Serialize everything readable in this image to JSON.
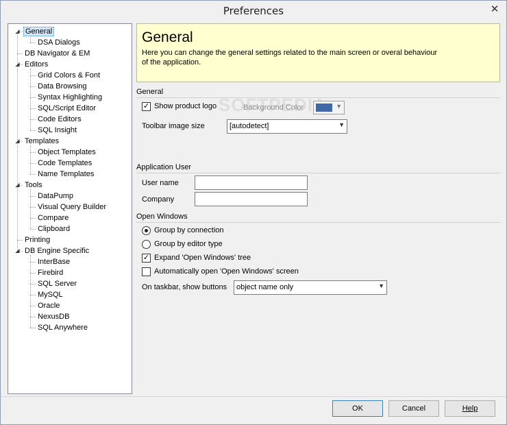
{
  "window": {
    "title": "Preferences",
    "close_glyph": "✕"
  },
  "tree": {
    "toggle_glyph": "◢",
    "items": [
      {
        "label": "General",
        "expandable": true,
        "selected": true
      },
      {
        "label": "DSA Dialogs"
      },
      {
        "label": "DB Navigator & EM"
      },
      {
        "label": "Editors",
        "expandable": true
      },
      {
        "label": "Grid Colors & Font"
      },
      {
        "label": "Data Browsing"
      },
      {
        "label": "Syntax Highlighting"
      },
      {
        "label": "SQL/Script Editor"
      },
      {
        "label": "Code Editors"
      },
      {
        "label": "SQL Insight"
      },
      {
        "label": "Templates",
        "expandable": true
      },
      {
        "label": "Object Templates"
      },
      {
        "label": "Code Templates"
      },
      {
        "label": "Name Templates"
      },
      {
        "label": "Tools",
        "expandable": true
      },
      {
        "label": "DataPump"
      },
      {
        "label": "Visual Query Builder"
      },
      {
        "label": "Compare"
      },
      {
        "label": "Clipboard"
      },
      {
        "label": "Printing"
      },
      {
        "label": "DB Engine Specific",
        "expandable": true
      },
      {
        "label": "InterBase"
      },
      {
        "label": "Firebird"
      },
      {
        "label": "SQL Server"
      },
      {
        "label": "MySQL"
      },
      {
        "label": "Oracle"
      },
      {
        "label": "NexusDB"
      },
      {
        "label": "SQL Anywhere"
      }
    ]
  },
  "header": {
    "title": "General",
    "description": "Here you can change the general settings related to the main screen or overal behaviour of the application."
  },
  "general": {
    "section_label": "General",
    "show_logo_label": "Show product logo",
    "show_logo_checked": true,
    "background_color_label": "Background Color",
    "background_color": "#4169a8",
    "toolbar_size_label": "Toolbar image size",
    "toolbar_size_value": "[autodetect]"
  },
  "app_user": {
    "section_label": "Application User",
    "user_name_label": "User name",
    "user_name_value": "",
    "company_label": "Company",
    "company_value": ""
  },
  "open_windows": {
    "section_label": "Open Windows",
    "group_connection_label": "Group by connection",
    "group_editor_label": "Group by editor type",
    "expand_tree_label": "Expand 'Open Windows' tree",
    "expand_tree_checked": true,
    "auto_open_label": "Automatically open 'Open Windows' screen",
    "auto_open_checked": false,
    "taskbar_label": "On taskbar, show buttons",
    "taskbar_value": "object name only"
  },
  "watermark": "SOFTPEDIA",
  "buttons": {
    "ok": "OK",
    "cancel": "Cancel",
    "help": "Help"
  },
  "icons": {
    "check": "✓",
    "dropdown": "▼"
  }
}
